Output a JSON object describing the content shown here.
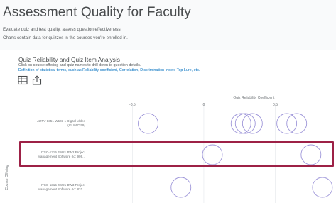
{
  "page": {
    "title": "Assessment Quality for Faculty",
    "description_line1": "Evaluate quiz and test quality, assess question effectiveness.",
    "description_line2": "Charts contain data for quizzes in the courses you're enrolled in."
  },
  "panel": {
    "title": "Quiz Reliability and Quiz Item Analysis",
    "help": "Click on course offering and quiz names to drill down to question details.",
    "definitions_link": "Definition of statistical terms, such as Reliability coefficient, Correlation, Discrimination Index, Top Lure, etc.",
    "toolbar": {
      "table_view_icon": "table-icon",
      "export_icon": "export-icon"
    }
  },
  "colors": {
    "bubble_stroke": "#9e96d9",
    "highlight_border": "#9d2146",
    "link": "#006fbf",
    "gridline": "#e4e6ea"
  },
  "chart_data": {
    "type": "scatter",
    "xlabel": "Quiz Reliability Coefficient",
    "ylabel": "Course Offering",
    "x_ticks": [
      "-0.5",
      "0",
      "0.5"
    ],
    "xlim": [
      -0.8,
      0.9
    ],
    "highlighted_category": "ITSC-1315 4W21 BW2 Project Management Software (Id: 909...",
    "categories": [
      "ARTV-1351 W503 1 Digital Video (Id: 847259)",
      "ITSC-1315 4W21 BW2 Project Management Software (Id: 909...",
      "ITSC-1315 4W21 BW3 Project Management Software (Id: 831..."
    ],
    "series": [
      {
        "category": "ARTV-1351 W503 1 Digital Video (Id: 847259)",
        "x": [
          -0.39,
          0.26,
          0.29,
          0.34,
          0.58,
          0.65
        ]
      },
      {
        "category": "ITSC-1315 4W21 BW2 Project Management Software (Id: 909...",
        "x": [
          0.06,
          0.75
        ]
      },
      {
        "category": "ITSC-1315 4W21 BW3 Project Management Software (Id: 831...",
        "x": [
          -0.16,
          0.83
        ]
      }
    ]
  }
}
